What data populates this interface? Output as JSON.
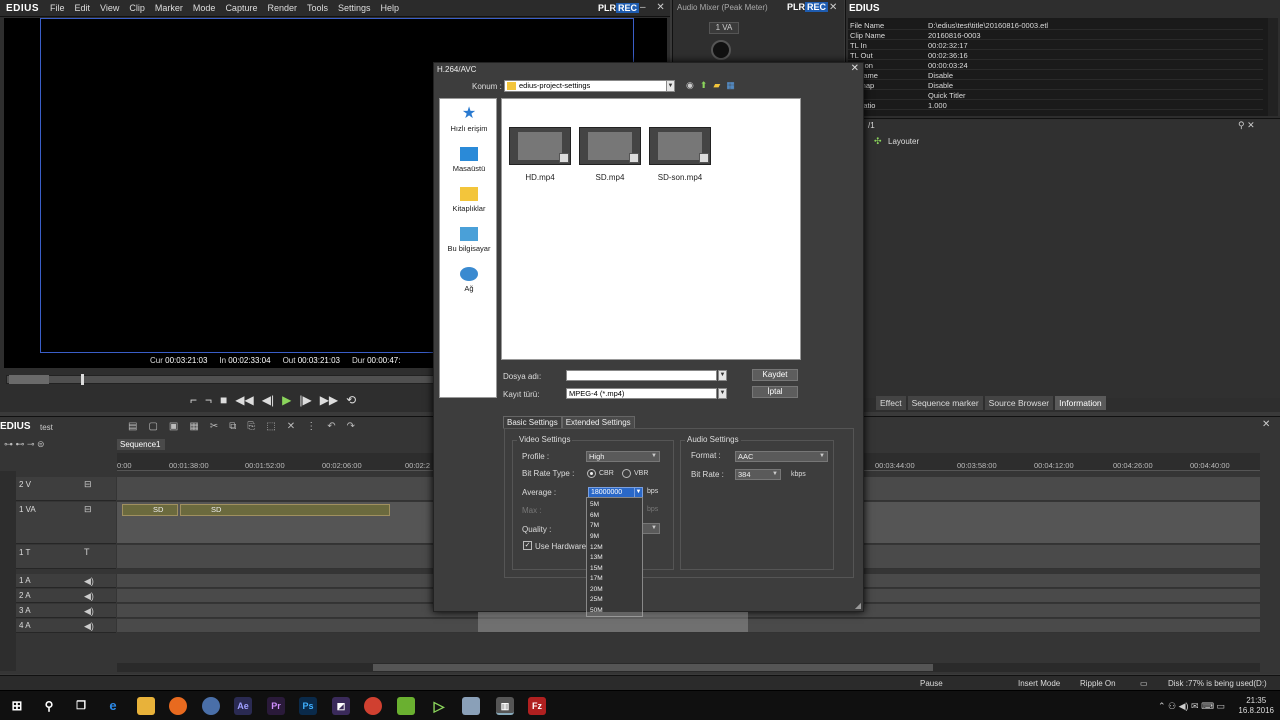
{
  "app": {
    "logo": "EDIUS",
    "menu": [
      "File",
      "Edit",
      "View",
      "Clip",
      "Marker",
      "Mode",
      "Capture",
      "Render",
      "Tools",
      "Settings",
      "Help"
    ],
    "plr": "PLR",
    "rec": "REC"
  },
  "player": {
    "cur": "00:03:21:03",
    "in": "00:02:33:04",
    "out": "00:03:21:03",
    "dur": "00:00:47:",
    "cur_lbl": "Cur",
    "in_lbl": "In",
    "out_lbl": "Out",
    "dur_lbl": "Dur"
  },
  "mixer": {
    "title": "Audio Mixer (Peak Meter)",
    "plr": "PLR",
    "rec": "REC",
    "channel": "1 VA"
  },
  "info": {
    "logo": "EDIUS",
    "rows": [
      {
        "k": "File Name",
        "v": "D:\\edius\\test\\title\\20160816-0003.etl"
      },
      {
        "k": "Clip Name",
        "v": "20160816-0003"
      },
      {
        "k": "TL In",
        "v": "00:02:32:17"
      },
      {
        "k": "TL Out",
        "v": "00:02:36:16"
      },
      {
        "k": "uration",
        "v": "00:00:03:24"
      },
      {
        "k": "e Frame",
        "v": "Disable"
      },
      {
        "k": "Remap",
        "v": "Disable"
      },
      {
        "k": "c",
        "v": "Quick Titler"
      },
      {
        "k": "ct Ratio",
        "v": "1.000"
      }
    ],
    "page": "/1",
    "layouter": "Layouter",
    "tabs": [
      "Effect",
      "Sequence marker",
      "Source Browser",
      "Information"
    ]
  },
  "timeline": {
    "logo": "EDIUS",
    "project": "test",
    "sequence": "Sequence1",
    "ticks": [
      "0:00",
      "00:01:38:00",
      "00:01:52:00",
      "00:02:06:00",
      "00:02:2",
      "00:03:44:00",
      "00:03:58:00",
      "00:04:12:00",
      "00:04:26:00",
      "00:04:40:00"
    ],
    "tracks": [
      {
        "name": "2 V"
      },
      {
        "name": "1 VA"
      },
      {
        "name": "1 T"
      },
      {
        "name": "1 A"
      },
      {
        "name": "2 A"
      },
      {
        "name": "3 A"
      },
      {
        "name": "4 A"
      }
    ],
    "clip_label": "SD"
  },
  "status": {
    "pause": "Pause",
    "insert": "Insert Mode",
    "ripple": "Ripple On",
    "disk": "Disk :77% is being used(D:)"
  },
  "clock": {
    "time": "21:35",
    "date": "16.8.2016"
  },
  "dialog": {
    "title": "H.264/AVC",
    "konum_lbl": "Konum :",
    "folder": "edius-project-settings",
    "places": [
      "Hızlı erişim",
      "Masaüstü",
      "Kitaplıklar",
      "Bu bilgisayar",
      "Ağ"
    ],
    "files": [
      "HD.mp4",
      "SD.mp4",
      "SD-son.mp4"
    ],
    "filename_lbl": "Dosya adı:",
    "filename": "",
    "filetype_lbl": "Kayıt türü:",
    "filetype": "MPEG-4 (*.mp4)",
    "save": "Kaydet",
    "cancel": "İptal",
    "tab_basic": "Basic Settings",
    "tab_ext": "Extended Settings",
    "video": {
      "title": "Video Settings",
      "profile_lbl": "Profile :",
      "profile": "High",
      "bitrate_type_lbl": "Bit Rate Type :",
      "cbr": "CBR",
      "vbr": "VBR",
      "average_lbl": "Average :",
      "average": "18000000",
      "bps": "bps",
      "max_lbl": "Max :",
      "quality_lbl": "Quality :",
      "hw": "Use Hardware E"
    },
    "audio": {
      "title": "Audio Settings",
      "format_lbl": "Format :",
      "format": "AAC",
      "bitrate_lbl": "Bit Rate :",
      "bitrate": "384",
      "kbps": "kbps"
    },
    "options": [
      "5M",
      "6M",
      "7M",
      "9M",
      "12M",
      "13M",
      "15M",
      "17M",
      "20M",
      "25M",
      "50M"
    ]
  }
}
